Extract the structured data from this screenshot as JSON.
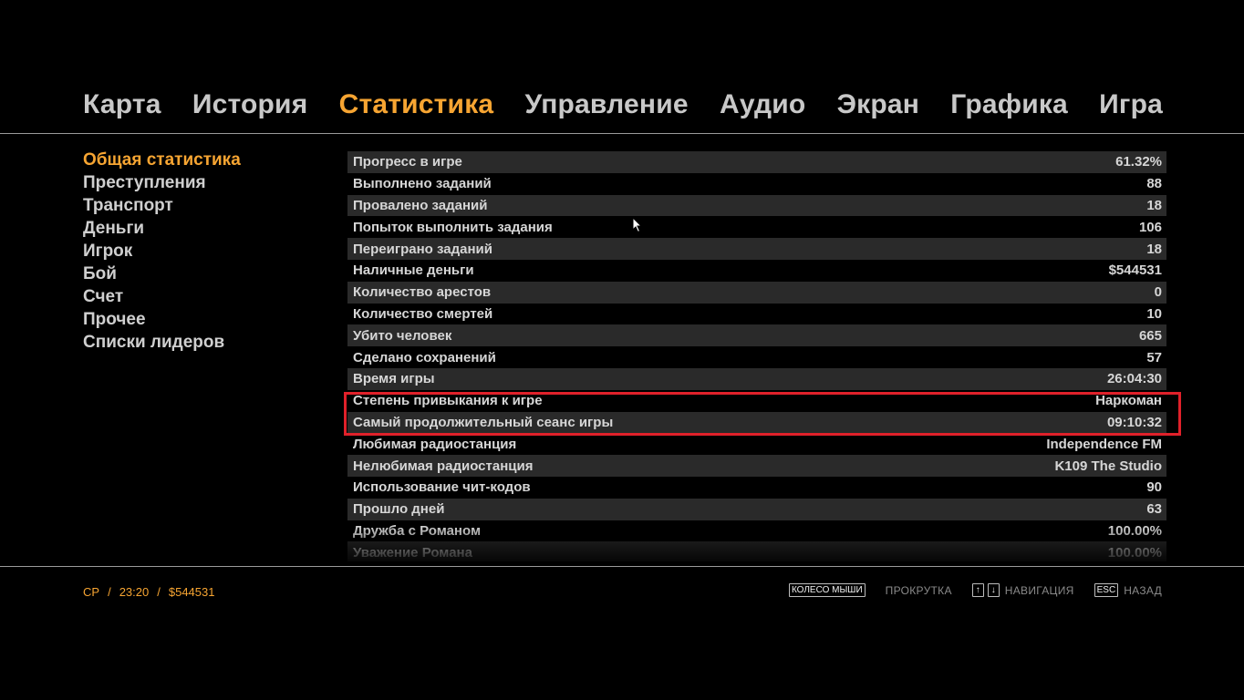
{
  "nav": {
    "tabs": [
      {
        "label": "Карта",
        "active": false
      },
      {
        "label": "История",
        "active": false
      },
      {
        "label": "Статистика",
        "active": true
      },
      {
        "label": "Управление",
        "active": false
      },
      {
        "label": "Аудио",
        "active": false
      },
      {
        "label": "Экран",
        "active": false
      },
      {
        "label": "Графика",
        "active": false
      },
      {
        "label": "Игра",
        "active": false
      }
    ]
  },
  "sidebar": {
    "items": [
      {
        "label": "Общая статистика",
        "active": true
      },
      {
        "label": "Преступления",
        "active": false
      },
      {
        "label": "Транспорт",
        "active": false
      },
      {
        "label": "Деньги",
        "active": false
      },
      {
        "label": "Игрок",
        "active": false
      },
      {
        "label": "Бой",
        "active": false
      },
      {
        "label": "Счет",
        "active": false
      },
      {
        "label": "Прочее",
        "active": false
      },
      {
        "label": "Списки лидеров",
        "active": false
      }
    ]
  },
  "stats": {
    "rows": [
      {
        "label": "Прогресс в игре",
        "value": "61.32%"
      },
      {
        "label": "Выполнено заданий",
        "value": "88"
      },
      {
        "label": "Провалено заданий",
        "value": "18"
      },
      {
        "label": "Попыток выполнить задания",
        "value": "106"
      },
      {
        "label": "Переиграно заданий",
        "value": "18"
      },
      {
        "label": "Наличные деньги",
        "value": "$544531"
      },
      {
        "label": "Количество арестов",
        "value": "0"
      },
      {
        "label": "Количество смертей",
        "value": "10"
      },
      {
        "label": "Убито человек",
        "value": "665"
      },
      {
        "label": "Сделано сохранений",
        "value": "57"
      },
      {
        "label": "Время игры",
        "value": "26:04:30"
      },
      {
        "label": "Степень привыкания к игре",
        "value": "Наркоман"
      },
      {
        "label": "Самый продолжительный сеанс игры",
        "value": "09:10:32"
      },
      {
        "label": "Любимая радиостанция",
        "value": "Independence FM"
      },
      {
        "label": "Нелюбимая радиостанция",
        "value": "K109 The Studio"
      },
      {
        "label": "Использование чит-кодов",
        "value": "90"
      },
      {
        "label": "Прошло дней",
        "value": "63"
      },
      {
        "label": "Дружба с Романом",
        "value": "100.00%"
      },
      {
        "label": "Уважение Романа",
        "value": "100.00%"
      }
    ]
  },
  "footer": {
    "save_slot": "CP",
    "time": "23:20",
    "money": "$544531",
    "separator": "/",
    "mouse_wheel_key": "КОЛЕСО МЫШИ",
    "scroll_label": "ПРОКРУТКА",
    "arrow_up_key": "↑",
    "arrow_down_key": "↓",
    "navigation_label": "НАВИГАЦИЯ",
    "esc_key": "ESC",
    "back_label": "НАЗАД"
  },
  "colors": {
    "accent": "#f7a532",
    "highlight_border": "#e0212a",
    "row_stripe": "#2a2a2a"
  }
}
